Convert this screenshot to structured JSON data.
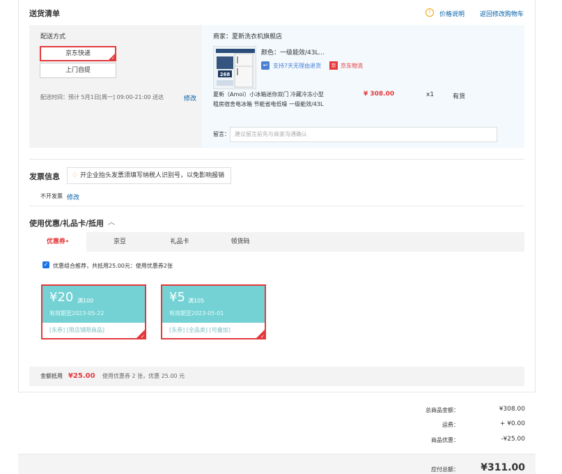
{
  "delivery": {
    "title": "送货清单",
    "price_note": "价格说明",
    "back_to_cart": "返回修改购物车",
    "ship_method_label": "配送方式",
    "ship_options": [
      "京东快递",
      "上门自提"
    ],
    "ship_time": "配送时间：预计 5月1日[周一] 09:00-21:00 送达",
    "modify": "修改"
  },
  "shop": {
    "label": "商家：夏新洗衣机旗舰店",
    "color_spec": "颜色：一级能效/43L...",
    "return_policy": "支持7天无理由退货",
    "logistics_badge": "京",
    "logistics": "京东物流",
    "product_title_line1": "夏新（Amoi）小冰箱迷你双门 冷藏冷冻小型",
    "product_title_line2": "租房宿舍电冰箱 节能省电低噪 一级能效/43L",
    "price": "¥ 308.00",
    "qty": "x1",
    "stock": "有货",
    "note_label": "留言：",
    "note_placeholder": "建议留言前先与商家沟通确认",
    "img_badge": "268"
  },
  "invoice": {
    "title": "发票信息",
    "tip": "开企业抬头发票须填写纳税人识别号，以免影响报销",
    "value": "不开发票",
    "modify": "修改"
  },
  "discount": {
    "title": "使用优惠/礼品卡/抵用",
    "tabs": [
      "优惠券",
      "京豆",
      "礼品卡",
      "领货码"
    ],
    "recommend": "优惠组合推荐，共抵用25.00元：使用优惠券2张",
    "coupons": [
      {
        "amount": "¥20",
        "cond": "满100",
        "valid": "有效期至2023-05-22",
        "tags": "[东券] [限店铺限商品]"
      },
      {
        "amount": "¥5",
        "cond": "满105",
        "valid": "有效期至2023-05-01",
        "tags": "[东券] [全品类] [可叠加]"
      }
    ],
    "footer_label": "金额抵用",
    "footer_amount": "¥25.00",
    "footer_desc": "使用优惠券 2 张，优惠 25.00 元"
  },
  "summary": {
    "total_label": "总商品金额：",
    "total_value": "¥308.00",
    "shipping_label": "运费：",
    "shipping_value": "+ ¥0.00",
    "discount_label": "商品优惠：",
    "discount_value": "-¥25.00",
    "payable_label": "应付总额：",
    "payable_value": "¥311.00"
  },
  "colors": {
    "accent": "#e4393c",
    "link": "#005ea7",
    "coupon": "#74d2d4"
  }
}
